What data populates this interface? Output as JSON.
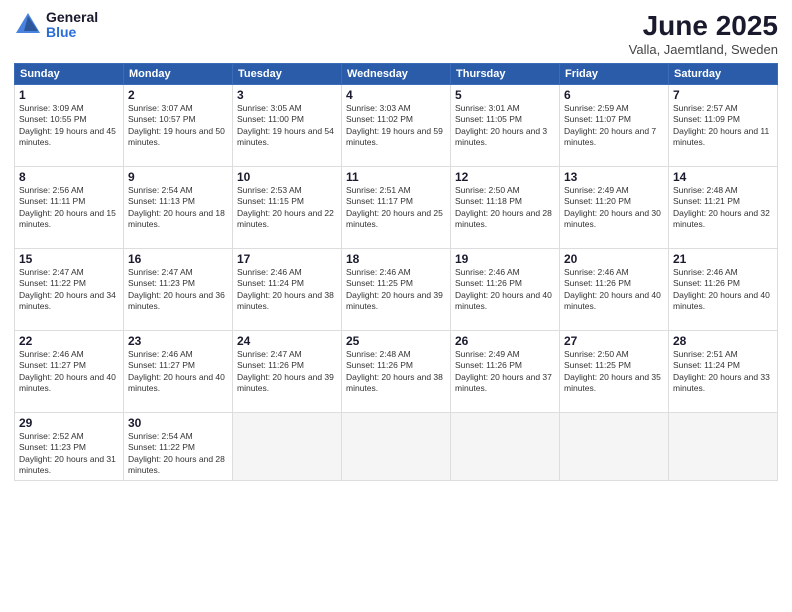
{
  "logo": {
    "general": "General",
    "blue": "Blue"
  },
  "title": "June 2025",
  "location": "Valla, Jaemtland, Sweden",
  "weekdays": [
    "Sunday",
    "Monday",
    "Tuesday",
    "Wednesday",
    "Thursday",
    "Friday",
    "Saturday"
  ],
  "weeks": [
    [
      {
        "day": 1,
        "sunrise": "Sunrise: 3:09 AM",
        "sunset": "Sunset: 10:55 PM",
        "daylight": "Daylight: 19 hours and 45 minutes."
      },
      {
        "day": 2,
        "sunrise": "Sunrise: 3:07 AM",
        "sunset": "Sunset: 10:57 PM",
        "daylight": "Daylight: 19 hours and 50 minutes."
      },
      {
        "day": 3,
        "sunrise": "Sunrise: 3:05 AM",
        "sunset": "Sunset: 11:00 PM",
        "daylight": "Daylight: 19 hours and 54 minutes."
      },
      {
        "day": 4,
        "sunrise": "Sunrise: 3:03 AM",
        "sunset": "Sunset: 11:02 PM",
        "daylight": "Daylight: 19 hours and 59 minutes."
      },
      {
        "day": 5,
        "sunrise": "Sunrise: 3:01 AM",
        "sunset": "Sunset: 11:05 PM",
        "daylight": "Daylight: 20 hours and 3 minutes."
      },
      {
        "day": 6,
        "sunrise": "Sunrise: 2:59 AM",
        "sunset": "Sunset: 11:07 PM",
        "daylight": "Daylight: 20 hours and 7 minutes."
      },
      {
        "day": 7,
        "sunrise": "Sunrise: 2:57 AM",
        "sunset": "Sunset: 11:09 PM",
        "daylight": "Daylight: 20 hours and 11 minutes."
      }
    ],
    [
      {
        "day": 8,
        "sunrise": "Sunrise: 2:56 AM",
        "sunset": "Sunset: 11:11 PM",
        "daylight": "Daylight: 20 hours and 15 minutes."
      },
      {
        "day": 9,
        "sunrise": "Sunrise: 2:54 AM",
        "sunset": "Sunset: 11:13 PM",
        "daylight": "Daylight: 20 hours and 18 minutes."
      },
      {
        "day": 10,
        "sunrise": "Sunrise: 2:53 AM",
        "sunset": "Sunset: 11:15 PM",
        "daylight": "Daylight: 20 hours and 22 minutes."
      },
      {
        "day": 11,
        "sunrise": "Sunrise: 2:51 AM",
        "sunset": "Sunset: 11:17 PM",
        "daylight": "Daylight: 20 hours and 25 minutes."
      },
      {
        "day": 12,
        "sunrise": "Sunrise: 2:50 AM",
        "sunset": "Sunset: 11:18 PM",
        "daylight": "Daylight: 20 hours and 28 minutes."
      },
      {
        "day": 13,
        "sunrise": "Sunrise: 2:49 AM",
        "sunset": "Sunset: 11:20 PM",
        "daylight": "Daylight: 20 hours and 30 minutes."
      },
      {
        "day": 14,
        "sunrise": "Sunrise: 2:48 AM",
        "sunset": "Sunset: 11:21 PM",
        "daylight": "Daylight: 20 hours and 32 minutes."
      }
    ],
    [
      {
        "day": 15,
        "sunrise": "Sunrise: 2:47 AM",
        "sunset": "Sunset: 11:22 PM",
        "daylight": "Daylight: 20 hours and 34 minutes."
      },
      {
        "day": 16,
        "sunrise": "Sunrise: 2:47 AM",
        "sunset": "Sunset: 11:23 PM",
        "daylight": "Daylight: 20 hours and 36 minutes."
      },
      {
        "day": 17,
        "sunrise": "Sunrise: 2:46 AM",
        "sunset": "Sunset: 11:24 PM",
        "daylight": "Daylight: 20 hours and 38 minutes."
      },
      {
        "day": 18,
        "sunrise": "Sunrise: 2:46 AM",
        "sunset": "Sunset: 11:25 PM",
        "daylight": "Daylight: 20 hours and 39 minutes."
      },
      {
        "day": 19,
        "sunrise": "Sunrise: 2:46 AM",
        "sunset": "Sunset: 11:26 PM",
        "daylight": "Daylight: 20 hours and 40 minutes."
      },
      {
        "day": 20,
        "sunrise": "Sunrise: 2:46 AM",
        "sunset": "Sunset: 11:26 PM",
        "daylight": "Daylight: 20 hours and 40 minutes."
      },
      {
        "day": 21,
        "sunrise": "Sunrise: 2:46 AM",
        "sunset": "Sunset: 11:26 PM",
        "daylight": "Daylight: 20 hours and 40 minutes."
      }
    ],
    [
      {
        "day": 22,
        "sunrise": "Sunrise: 2:46 AM",
        "sunset": "Sunset: 11:27 PM",
        "daylight": "Daylight: 20 hours and 40 minutes."
      },
      {
        "day": 23,
        "sunrise": "Sunrise: 2:46 AM",
        "sunset": "Sunset: 11:27 PM",
        "daylight": "Daylight: 20 hours and 40 minutes."
      },
      {
        "day": 24,
        "sunrise": "Sunrise: 2:47 AM",
        "sunset": "Sunset: 11:26 PM",
        "daylight": "Daylight: 20 hours and 39 minutes."
      },
      {
        "day": 25,
        "sunrise": "Sunrise: 2:48 AM",
        "sunset": "Sunset: 11:26 PM",
        "daylight": "Daylight: 20 hours and 38 minutes."
      },
      {
        "day": 26,
        "sunrise": "Sunrise: 2:49 AM",
        "sunset": "Sunset: 11:26 PM",
        "daylight": "Daylight: 20 hours and 37 minutes."
      },
      {
        "day": 27,
        "sunrise": "Sunrise: 2:50 AM",
        "sunset": "Sunset: 11:25 PM",
        "daylight": "Daylight: 20 hours and 35 minutes."
      },
      {
        "day": 28,
        "sunrise": "Sunrise: 2:51 AM",
        "sunset": "Sunset: 11:24 PM",
        "daylight": "Daylight: 20 hours and 33 minutes."
      }
    ],
    [
      {
        "day": 29,
        "sunrise": "Sunrise: 2:52 AM",
        "sunset": "Sunset: 11:23 PM",
        "daylight": "Daylight: 20 hours and 31 minutes."
      },
      {
        "day": 30,
        "sunrise": "Sunrise: 2:54 AM",
        "sunset": "Sunset: 11:22 PM",
        "daylight": "Daylight: 20 hours and 28 minutes."
      },
      null,
      null,
      null,
      null,
      null
    ]
  ]
}
